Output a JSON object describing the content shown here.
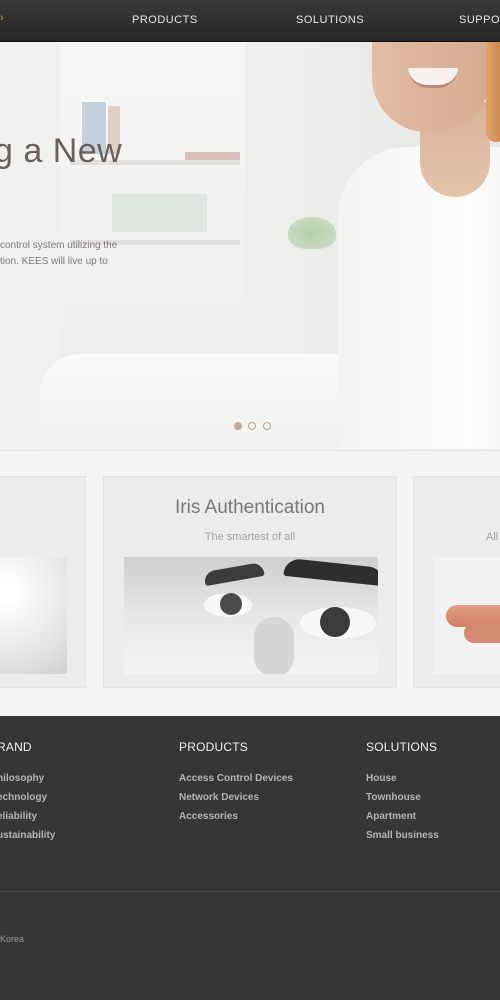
{
  "nav": {
    "items": [
      "PRODUCTS",
      "SOLUTIONS",
      "SUPPORT"
    ]
  },
  "hero": {
    "headline": "g a New",
    "description_line1": "control system utilizing the",
    "description_line2": "tion. KEES will live up to",
    "slides_total": 3,
    "active_slide": 1
  },
  "cards": {
    "center": {
      "title": "Iris Authentication",
      "subtitle": "The smartest of all"
    },
    "right": {
      "subtitle": "All"
    }
  },
  "footer": {
    "brand": {
      "heading": "RAND",
      "links": [
        "hilosophy",
        "echnology",
        "eliability",
        "ustainability"
      ]
    },
    "products": {
      "heading": "PRODUCTS",
      "links": [
        "Access Control Devices",
        "Network Devices",
        "Accessories"
      ]
    },
    "solutions": {
      "heading": "SOLUTIONS",
      "links": [
        "House",
        "Townhouse",
        "Apartment",
        "Small business"
      ]
    },
    "copyright": "Korea"
  },
  "colors": {
    "accent": "#c4ab93",
    "nav_bg": "#2d2d2d",
    "footer_bg": "#363636"
  }
}
